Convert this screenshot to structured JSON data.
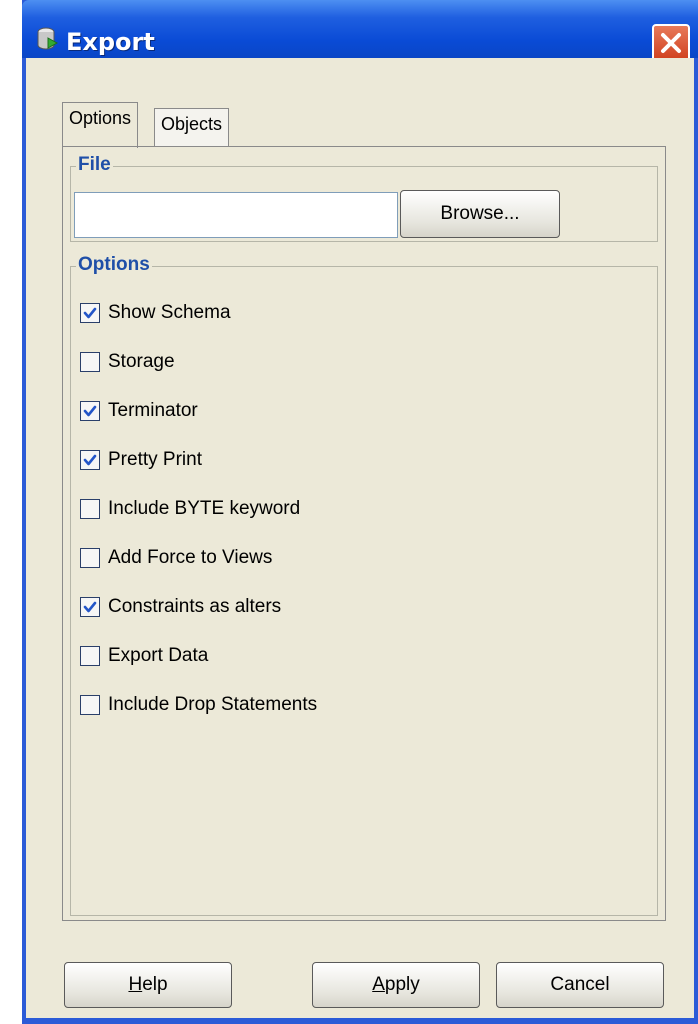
{
  "window": {
    "title": "Export"
  },
  "tabs": [
    {
      "label": "Options",
      "active": true
    },
    {
      "label": "Objects",
      "active": false
    }
  ],
  "file_group": {
    "legend": "File",
    "path_value": "",
    "browse_label": "Browse..."
  },
  "options_group": {
    "legend": "Options",
    "items": [
      {
        "label": "Show Schema",
        "checked": true
      },
      {
        "label": "Storage",
        "checked": false
      },
      {
        "label": "Terminator",
        "checked": true
      },
      {
        "label": "Pretty Print",
        "checked": true
      },
      {
        "label": "Include BYTE keyword",
        "checked": false
      },
      {
        "label": "Add Force to Views",
        "checked": false
      },
      {
        "label": "Constraints as alters",
        "checked": true
      },
      {
        "label": "Export Data",
        "checked": false
      },
      {
        "label": "Include Drop Statements",
        "checked": false
      }
    ]
  },
  "buttons": {
    "help": {
      "mnemonic": "H",
      "rest": "elp"
    },
    "apply": {
      "mnemonic": "A",
      "rest": "pply"
    },
    "cancel": "Cancel"
  },
  "colors": {
    "title_bar": "#0a4bd6",
    "frame": "#2b5bd7",
    "legend_text": "#1f4fa8",
    "checkmark": "#2355c8"
  }
}
